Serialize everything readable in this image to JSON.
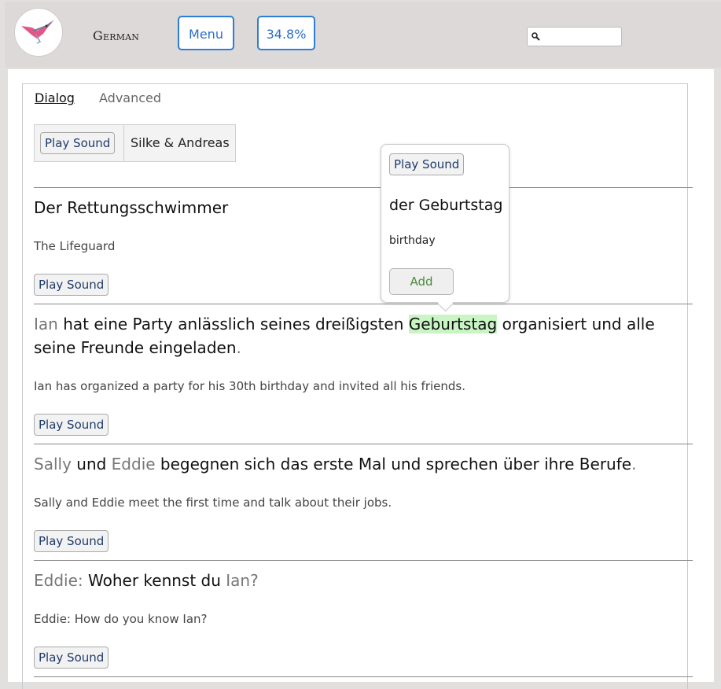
{
  "header": {
    "language": "German",
    "menu_label": "Menu",
    "progress_label": "34.8%",
    "search_placeholder": ""
  },
  "tabs": {
    "dialog": "Dialog",
    "advanced": "Advanced"
  },
  "speakers": {
    "play_label": "Play Sound",
    "names": "Silke & Andreas"
  },
  "lines": [
    {
      "title": "Der Rettungsschwimmer",
      "translation": "The Lifeguard",
      "play_label": "Play Sound"
    },
    {
      "speaker": "Ian",
      "text_a": " hat eine Party anlässlich seines dreißigsten ",
      "highlight": "Geburtstag",
      "text_b": " organisiert und alle",
      "text_c": "seine Freunde eingeladen",
      "punct": ".",
      "translation": "Ian has organized a party for his 30th birthday and invited all his friends.",
      "play_label": "Play Sound"
    },
    {
      "name1": "Sally",
      "text_a": " und ",
      "name2": "Eddie",
      "text_b": " begegnen sich das erste Mal und sprechen über ihre Berufe",
      "punct": ".",
      "translation": "Sally and Eddie meet the first time and talk about their jobs.",
      "play_label": "Play Sound"
    },
    {
      "speaker": "Eddie:",
      "text_a": " Woher kennst du ",
      "name": "Ian",
      "punct": "?",
      "translation": "Eddie: How do you know Ian?",
      "play_label": "Play Sound"
    }
  ],
  "popover": {
    "play_label": "Play Sound",
    "word": "der Geburtstag",
    "translation": "birthday",
    "add_label": "Add"
  },
  "colors": {
    "accent": "#2e7dd8",
    "highlight": "#c9f5c5",
    "add_text": "#4d8a3a"
  }
}
